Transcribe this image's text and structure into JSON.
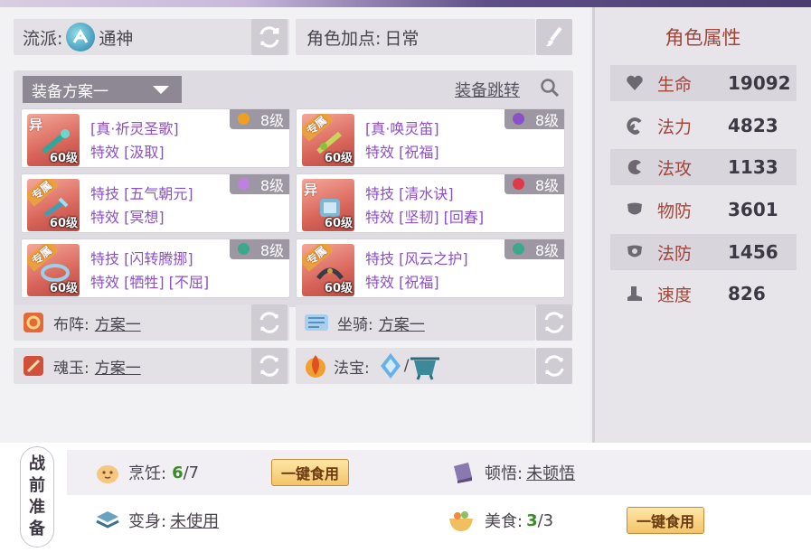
{
  "top": {
    "sect_label": "流派:",
    "sect_value": "通神",
    "points_label": "角色加点:",
    "points_value": "日常"
  },
  "equipment": {
    "plan_name": "装备方案一",
    "jump_label": "装备跳转",
    "items": [
      {
        "tag": "异",
        "level_req": "60级",
        "line1": "[真·祈灵圣歌]",
        "line2": "特效 [汲取]",
        "gem_level": "8级",
        "gem_color": "#f0a020"
      },
      {
        "tag": "专属",
        "level_req": "60级",
        "line1": "[真·唤灵笛]",
        "line2": "特效 [祝福]",
        "gem_level": "8级",
        "gem_color": "#8a50c8"
      },
      {
        "tag": "专属",
        "level_req": "60级",
        "line1": "特技 [五气朝元]",
        "line2": "特效 [冥想]",
        "gem_level": "8级",
        "gem_color": "#c080e0"
      },
      {
        "tag": "异",
        "level_req": "60级",
        "line1": "特技 [清水诀]",
        "line2": "特效 [坚韧] [回春]",
        "gem_level": "8级",
        "gem_color": "#e03a4a"
      },
      {
        "tag": "专属",
        "level_req": "60级",
        "line1": "特技 [闪转腾挪]",
        "line2": "特效 [牺牲] [不屈]",
        "gem_level": "8级",
        "gem_color": "#3aa88a"
      },
      {
        "tag": "专属",
        "level_req": "60级",
        "line1": "特技 [风云之护]",
        "line2": "特效 [祝福]",
        "gem_level": "8级",
        "gem_color": "#3aa88a"
      }
    ]
  },
  "setup": {
    "formation_label": "布阵:",
    "formation_value": "方案一",
    "mount_label": "坐骑:",
    "mount_value": "方案一",
    "soul_label": "魂玉:",
    "soul_value": "方案一",
    "treasure_label": "法宝:",
    "treasure_sep": "/"
  },
  "attributes": {
    "title": "角色属性",
    "stats": [
      {
        "name": "生命",
        "value": "19092",
        "icon": "heart-icon"
      },
      {
        "name": "法力",
        "value": "4823",
        "icon": "swirl-icon"
      },
      {
        "name": "法攻",
        "value": "1133",
        "icon": "magic-attack-icon"
      },
      {
        "name": "物防",
        "value": "3601",
        "icon": "armor-icon"
      },
      {
        "name": "法防",
        "value": "1456",
        "icon": "magic-defense-icon"
      },
      {
        "name": "速度",
        "value": "826",
        "icon": "boot-icon"
      }
    ]
  },
  "prep": {
    "tag_chars": [
      "战",
      "前",
      "准",
      "备"
    ],
    "cook_label": "烹饪:",
    "cook_value": "6",
    "cook_total": "/7",
    "eat_button": "一键食用",
    "enlight_label": "顿悟:",
    "enlight_value": "未顿悟",
    "transform_label": "变身:",
    "transform_value": "未使用",
    "food_label": "美食:",
    "food_value": "3",
    "food_total": "/3",
    "eat_button_2": "一键食用"
  }
}
